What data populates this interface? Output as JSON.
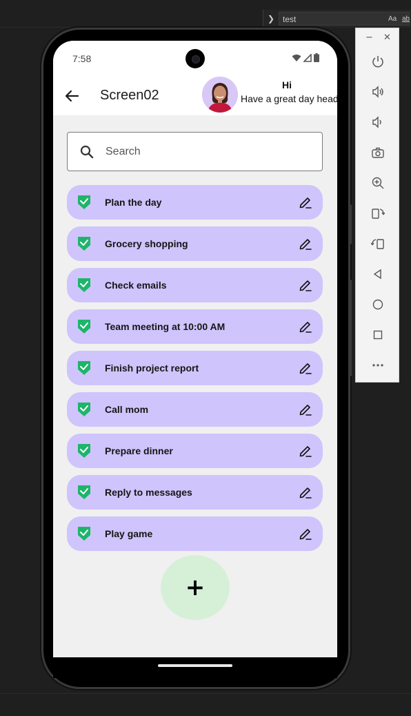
{
  "ide": {
    "find_value": "test",
    "find_case_label": "Aa",
    "find_word_label": "ab"
  },
  "status_bar": {
    "time": "7:58"
  },
  "app_bar": {
    "title": "Screen02",
    "greeting_title": "Hi",
    "greeting_subtitle": "Have a great day head"
  },
  "search": {
    "placeholder": "Search"
  },
  "tasks": [
    {
      "label": "Plan the day",
      "done": true
    },
    {
      "label": "Grocery shopping",
      "done": true
    },
    {
      "label": "Check emails",
      "done": true
    },
    {
      "label": "Team meeting at 10:00 AM",
      "done": true
    },
    {
      "label": "Finish project report",
      "done": true
    },
    {
      "label": "Call mom",
      "done": true
    },
    {
      "label": "Prepare dinner",
      "done": true
    },
    {
      "label": "Reply to messages",
      "done": true
    },
    {
      "label": "Play game",
      "done": true
    }
  ],
  "fab": {
    "label": "+"
  },
  "emulator_toolbar": {
    "minimize": "−",
    "close": "✕",
    "tools": [
      "power-icon",
      "volume-up-icon",
      "volume-down-icon",
      "camera-icon",
      "zoom-icon",
      "rotate-left-icon",
      "rotate-right-icon",
      "back-icon",
      "home-icon",
      "overview-icon",
      "more-icon"
    ]
  },
  "colors": {
    "task_bg": "#cfc4fc",
    "check_green": "#1db56a",
    "fab_bg": "#d6f0d8",
    "screen_bg": "#f0f0f0"
  }
}
